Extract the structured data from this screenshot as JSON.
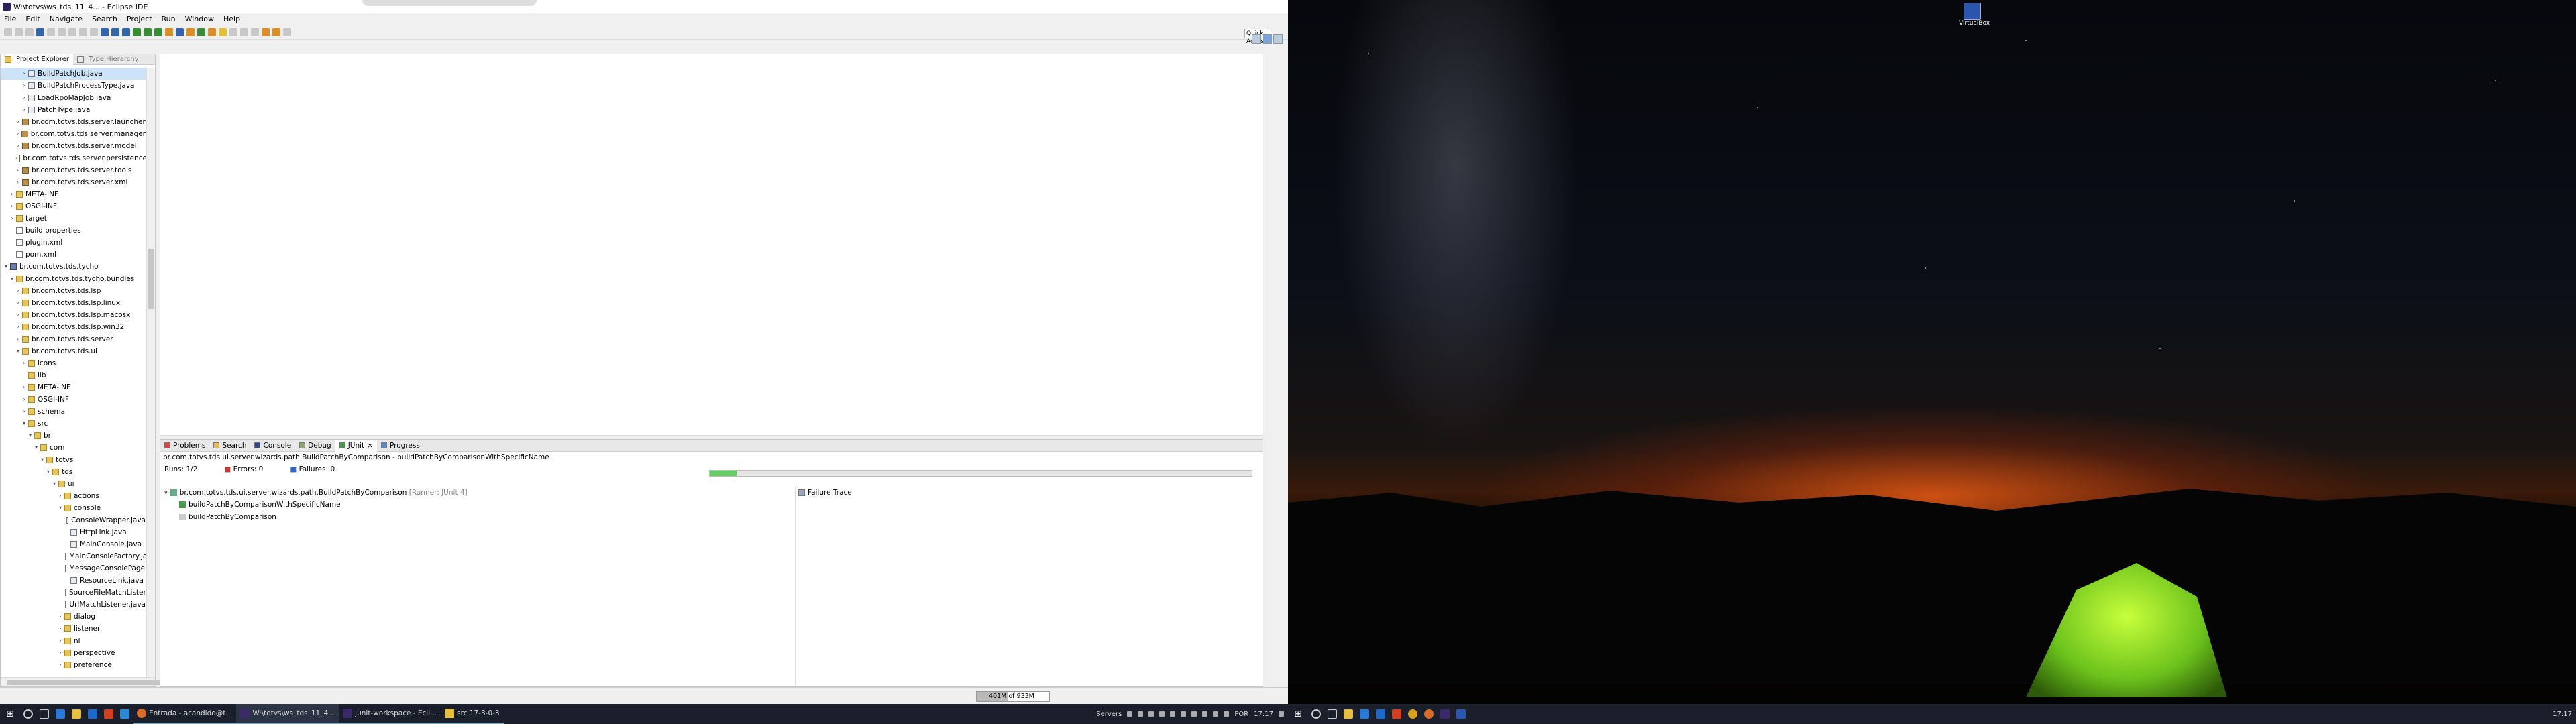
{
  "window": {
    "title": "W:\\totvs\\ws_tds_11_4... - Eclipse IDE"
  },
  "menu": [
    "File",
    "Edit",
    "Navigate",
    "Search",
    "Project",
    "Run",
    "Window",
    "Help"
  ],
  "quick_access": "Quick Access",
  "explorer": {
    "tab_active": "Project Explorer",
    "tab_inactive": "Type Hierarchy",
    "rows": [
      {
        "indent": 3,
        "arrow": ">",
        "icon": "java",
        "label": "BuildPatchJob.java",
        "selected": true
      },
      {
        "indent": 3,
        "arrow": ">",
        "icon": "java",
        "label": "BuildPatchProcessType.java"
      },
      {
        "indent": 3,
        "arrow": ">",
        "icon": "java",
        "label": "LoadRpoMapJob.java"
      },
      {
        "indent": 3,
        "arrow": ">",
        "icon": "java",
        "label": "PatchType.java"
      },
      {
        "indent": 2,
        "arrow": ">",
        "icon": "pkg",
        "label": "br.com.totvs.tds.server.launcher"
      },
      {
        "indent": 2,
        "arrow": ">",
        "icon": "pkg",
        "label": "br.com.totvs.tds.server.manager"
      },
      {
        "indent": 2,
        "arrow": ">",
        "icon": "pkg",
        "label": "br.com.totvs.tds.server.model"
      },
      {
        "indent": 2,
        "arrow": ">",
        "icon": "pkg",
        "label": "br.com.totvs.tds.server.persistence"
      },
      {
        "indent": 2,
        "arrow": ">",
        "icon": "pkg",
        "label": "br.com.totvs.tds.server.tools"
      },
      {
        "indent": 2,
        "arrow": ">",
        "icon": "pkg",
        "label": "br.com.totvs.tds.server.xml"
      },
      {
        "indent": 1,
        "arrow": ">",
        "icon": "folder",
        "label": "META-INF"
      },
      {
        "indent": 1,
        "arrow": ">",
        "icon": "folder",
        "label": "OSGI-INF"
      },
      {
        "indent": 1,
        "arrow": ">",
        "icon": "folder",
        "label": "target"
      },
      {
        "indent": 1,
        "arrow": "",
        "icon": "file",
        "label": "build.properties"
      },
      {
        "indent": 1,
        "arrow": "",
        "icon": "file",
        "label": "plugin.xml"
      },
      {
        "indent": 1,
        "arrow": "",
        "icon": "file",
        "label": "pom.xml"
      },
      {
        "indent": 0,
        "arrow": "v",
        "icon": "proj",
        "label": "br.com.totvs.tds.tycho"
      },
      {
        "indent": 1,
        "arrow": "v",
        "icon": "folder",
        "label": "br.com.totvs.tds.tycho.bundles"
      },
      {
        "indent": 2,
        "arrow": ">",
        "icon": "folder",
        "label": "br.com.totvs.tds.lsp"
      },
      {
        "indent": 2,
        "arrow": ">",
        "icon": "folder",
        "label": "br.com.totvs.tds.lsp.linux"
      },
      {
        "indent": 2,
        "arrow": ">",
        "icon": "folder",
        "label": "br.com.totvs.tds.lsp.macosx"
      },
      {
        "indent": 2,
        "arrow": ">",
        "icon": "folder",
        "label": "br.com.totvs.tds.lsp.win32"
      },
      {
        "indent": 2,
        "arrow": ">",
        "icon": "folder",
        "label": "br.com.totvs.tds.server"
      },
      {
        "indent": 2,
        "arrow": "v",
        "icon": "folder",
        "label": "br.com.totvs.tds.ui"
      },
      {
        "indent": 3,
        "arrow": ">",
        "icon": "folder",
        "label": "icons"
      },
      {
        "indent": 3,
        "arrow": "",
        "icon": "folder",
        "label": "lib"
      },
      {
        "indent": 3,
        "arrow": ">",
        "icon": "folder",
        "label": "META-INF"
      },
      {
        "indent": 3,
        "arrow": ">",
        "icon": "folder",
        "label": "OSGI-INF"
      },
      {
        "indent": 3,
        "arrow": ">",
        "icon": "folder",
        "label": "schema"
      },
      {
        "indent": 3,
        "arrow": "v",
        "icon": "folder",
        "label": "src"
      },
      {
        "indent": 4,
        "arrow": "v",
        "icon": "folder",
        "label": "br"
      },
      {
        "indent": 5,
        "arrow": "v",
        "icon": "folder",
        "label": "com"
      },
      {
        "indent": 6,
        "arrow": "v",
        "icon": "folder",
        "label": "totvs"
      },
      {
        "indent": 7,
        "arrow": "v",
        "icon": "folder",
        "label": "tds"
      },
      {
        "indent": 8,
        "arrow": "v",
        "icon": "folder",
        "label": "ui"
      },
      {
        "indent": 9,
        "arrow": ">",
        "icon": "folder",
        "label": "actions"
      },
      {
        "indent": 9,
        "arrow": "v",
        "icon": "folder",
        "label": "console"
      },
      {
        "indent": 10,
        "arrow": "",
        "icon": "java",
        "label": "ConsoleWrapper.java"
      },
      {
        "indent": 10,
        "arrow": "",
        "icon": "java",
        "label": "HttpLink.java"
      },
      {
        "indent": 10,
        "arrow": "",
        "icon": "java",
        "label": "MainConsole.java"
      },
      {
        "indent": 10,
        "arrow": "",
        "icon": "java",
        "label": "MainConsoleFactory.java"
      },
      {
        "indent": 10,
        "arrow": "",
        "icon": "java",
        "label": "MessageConsolePageParticipant.java"
      },
      {
        "indent": 10,
        "arrow": "",
        "icon": "java",
        "label": "ResourceLink.java"
      },
      {
        "indent": 10,
        "arrow": "",
        "icon": "java",
        "label": "SourceFileMatchListener.java"
      },
      {
        "indent": 10,
        "arrow": "",
        "icon": "java",
        "label": "UrlMatchListener.java"
      },
      {
        "indent": 9,
        "arrow": ">",
        "icon": "folder",
        "label": "dialog"
      },
      {
        "indent": 9,
        "arrow": ">",
        "icon": "folder",
        "label": "listener"
      },
      {
        "indent": 9,
        "arrow": ">",
        "icon": "folder",
        "label": "nl"
      },
      {
        "indent": 9,
        "arrow": ">",
        "icon": "folder",
        "label": "perspective"
      },
      {
        "indent": 9,
        "arrow": ">",
        "icon": "folder",
        "label": "preference"
      }
    ]
  },
  "bottom": {
    "tabs": [
      "Problems",
      "Search",
      "Console",
      "Debug",
      "JUnit",
      "Progress"
    ],
    "active_tab": "JUnit",
    "path": "br.com.totvs.tds.ui.server.wizards.path.BuildPatchByComparison - buildPatchByComparisonWithSpecificName",
    "runs_label": "Runs:",
    "runs_value": "1/2",
    "errors_label": "Errors:",
    "errors_value": "0",
    "failures_label": "Failures:",
    "failures_value": "0",
    "progress": 0.05,
    "suite": "br.com.totvs.tds.ui.server.wizards.path.BuildPatchByComparison",
    "suite_runner": "[Runner: JUnit 4]",
    "tests": [
      "buildPatchByComparisonWithSpecificName",
      "buildPatchByComparison"
    ],
    "failure_trace": "Failure Trace"
  },
  "status": {
    "heap": "401M of 933M",
    "heap_fraction": 0.43
  },
  "taskbar_left": {
    "items": [
      "Entrada - acandido@t...",
      "W:\\totvs\\ws_tds_11_4...",
      "junit-workspace - Ecli...",
      "src 17-3-0-3"
    ],
    "tray_label": "Servers",
    "lang": "POR",
    "time": "17:17"
  },
  "taskbar_right": {
    "time": "17:17"
  },
  "desktop_icon": {
    "label": "VirtualBox"
  }
}
